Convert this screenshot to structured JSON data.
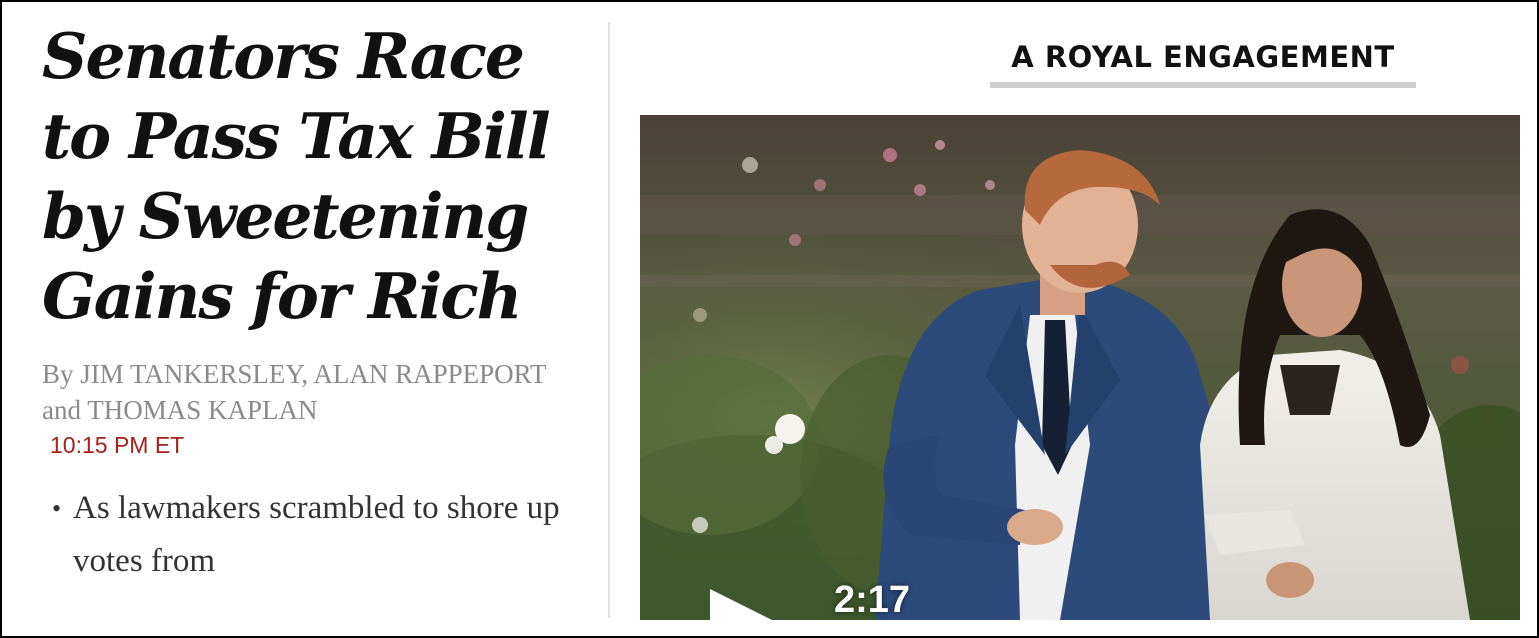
{
  "lead_story": {
    "headline": "Senators Race to Pass Tax Bill by Sweetening Gains for Rich",
    "byline": "By JIM TANKERSLEY, ALAN RAPPEPORT and THOMAS KAPLAN",
    "timestamp": "10:15 PM ET",
    "summary": [
      "As lawmakers scrambled to shore up votes from"
    ]
  },
  "feature": {
    "kicker": "A ROYAL ENGAGEMENT",
    "video": {
      "duration": "2:17",
      "play_icon": "play-icon"
    }
  },
  "colors": {
    "timestamp": "#a8201a",
    "byline": "#8a8a8a",
    "kicker_underline": "#cfcfcf",
    "divider": "#e2e2e2"
  }
}
